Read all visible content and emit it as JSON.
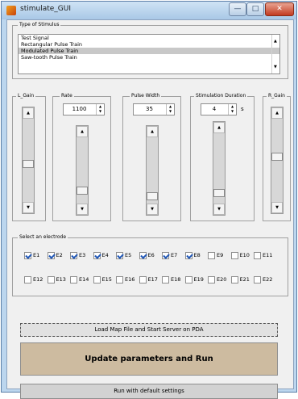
{
  "window": {
    "title": "stimulate_GUI"
  },
  "stimulus": {
    "panel_title": "Type of Stimulus",
    "options": [
      "Test Signal",
      "Rectangular Pulse Train",
      "Modulated Pulse Train",
      "Saw-tooth Pulse Train"
    ],
    "selected": "Modulated Pulse Train"
  },
  "controls": {
    "l_gain": {
      "label": "L_Gain",
      "level": 0.45
    },
    "rate": {
      "label": "Rate",
      "value": "1100",
      "level": 0.15
    },
    "pulse_width": {
      "label": "Pulse Width",
      "value": "35",
      "level": 0.05
    },
    "duration": {
      "label": "Stimulation Duration",
      "value": "4",
      "unit": "s",
      "level": 0.1
    },
    "r_gain": {
      "label": "R_Gain",
      "level": 0.55
    }
  },
  "electrodes": {
    "panel_title": "Select an electrode",
    "row1": [
      {
        "label": "E1",
        "checked": true
      },
      {
        "label": "E2",
        "checked": true
      },
      {
        "label": "E3",
        "checked": true
      },
      {
        "label": "E4",
        "checked": true
      },
      {
        "label": "E5",
        "checked": true
      },
      {
        "label": "E6",
        "checked": true
      },
      {
        "label": "E7",
        "checked": true
      },
      {
        "label": "E8",
        "checked": true
      },
      {
        "label": "E9",
        "checked": false
      },
      {
        "label": "E10",
        "checked": false
      },
      {
        "label": "E11",
        "checked": false
      }
    ],
    "row2": [
      {
        "label": "E12",
        "checked": false
      },
      {
        "label": "E13",
        "checked": false
      },
      {
        "label": "E14",
        "checked": false
      },
      {
        "label": "E15",
        "checked": false
      },
      {
        "label": "E16",
        "checked": false
      },
      {
        "label": "E17",
        "checked": false
      },
      {
        "label": "E18",
        "checked": false
      },
      {
        "label": "E19",
        "checked": false
      },
      {
        "label": "E20",
        "checked": false
      },
      {
        "label": "E21",
        "checked": false
      },
      {
        "label": "E22",
        "checked": false
      }
    ]
  },
  "buttons": {
    "load": "Load Map File and Start Server on PDA",
    "update": "Update parameters and Run",
    "defaults": "Run with default settings"
  },
  "colors": {
    "update_button": "#cdbba0",
    "title_bar": "#bcd6ee",
    "close_button": "#c23b21"
  }
}
